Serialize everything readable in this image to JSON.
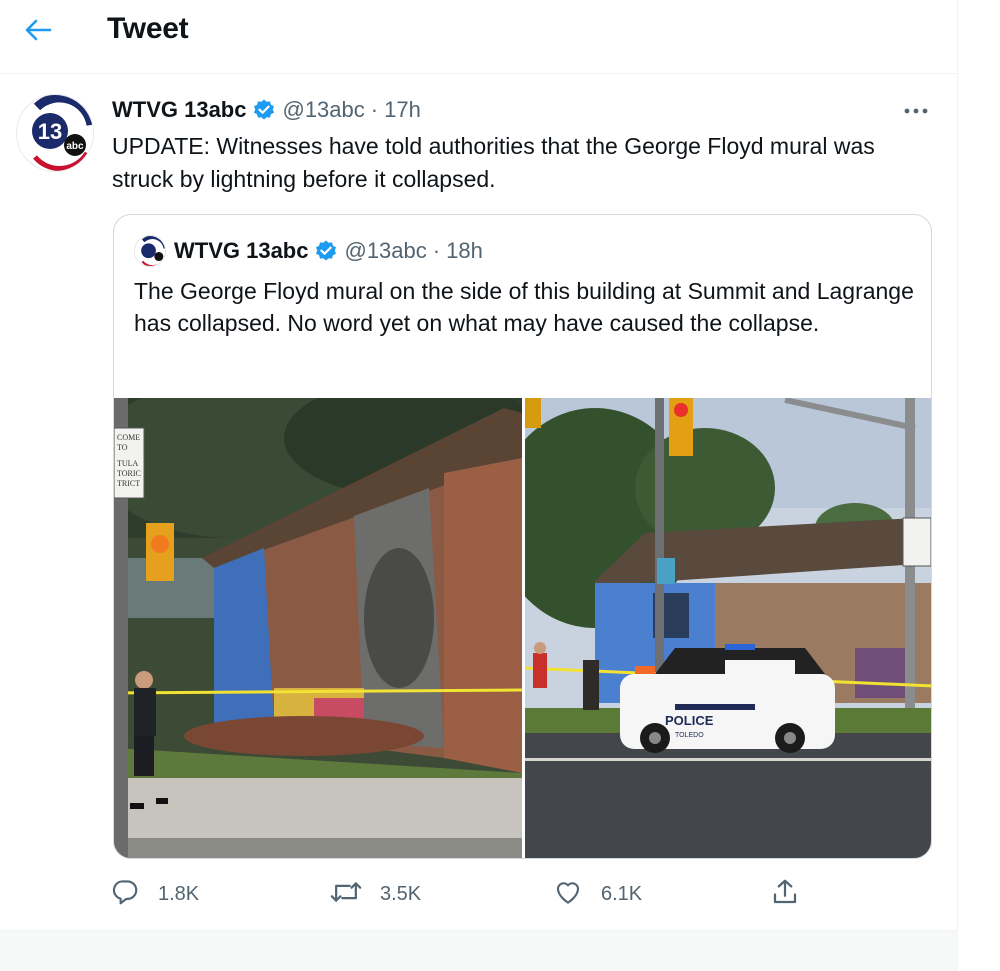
{
  "header": {
    "title": "Tweet"
  },
  "tweet": {
    "author_name": "WTVG 13abc",
    "handle": "@13abc",
    "separator": "·",
    "time": "17h",
    "text": "UPDATE: Witnesses have told authorities that the George Floyd mural was struck by lightning before it collapsed.",
    "avatar_logo": {
      "number": "13",
      "brand": "abc"
    }
  },
  "quoted_tweet": {
    "author_name": "WTVG 13abc",
    "handle": "@13abc",
    "separator": "·",
    "time": "18h",
    "text": "The George Floyd mural on the side of this building at Summit and Lagrange has collapsed. No word yet on what may have caused the collapse.",
    "photos": [
      {
        "description_icon": "collapsed-mural-photo-1"
      },
      {
        "description_icon": "collapsed-mural-photo-2",
        "signs": {
          "police_label": "POLICE",
          "police_sub": "TOLEDO"
        }
      }
    ],
    "photo1_sign": [
      "COME",
      "TO",
      "",
      "TULA",
      "TORIC",
      "TRICT"
    ]
  },
  "actions": {
    "reply_count": "1.8K",
    "retweet_count": "3.5K",
    "like_count": "6.1K"
  },
  "colors": {
    "accent": "#1d9bf0",
    "text_primary": "#0f1419",
    "text_secondary": "#536471",
    "border": "#cfd9de"
  }
}
